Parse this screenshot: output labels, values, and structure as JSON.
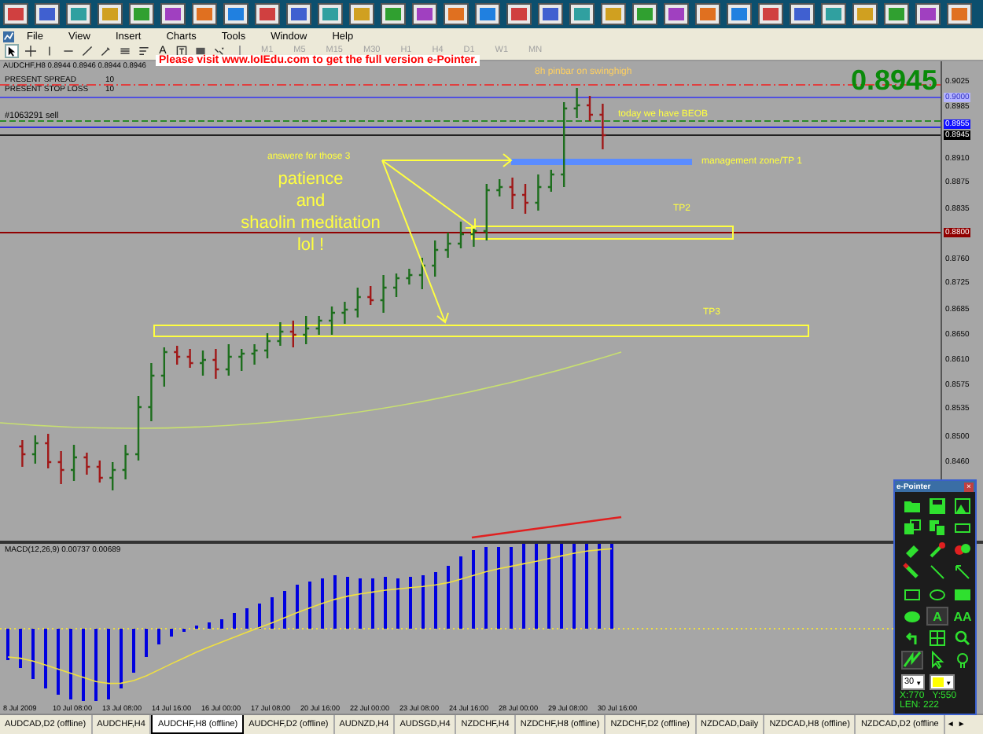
{
  "menu": [
    "File",
    "View",
    "Insert",
    "Charts",
    "Tools",
    "Window",
    "Help"
  ],
  "toolbar": {
    "tools": [
      {
        "kind": "cursor",
        "selected": true
      },
      {
        "kind": "crosshair",
        "selected": false
      },
      {
        "kind": "vline",
        "selected": false
      },
      {
        "kind": "hline",
        "selected": false
      },
      {
        "kind": "trendline",
        "selected": false
      },
      {
        "kind": "pen",
        "selected": false
      },
      {
        "kind": "channel",
        "selected": false
      },
      {
        "kind": "fibo",
        "selected": false
      },
      {
        "kind": "text",
        "label": "A",
        "selected": false
      },
      {
        "kind": "label",
        "selected": false
      },
      {
        "kind": "rect",
        "selected": false
      },
      {
        "kind": "arrows",
        "selected": false
      }
    ],
    "timeframes": [
      {
        "label": "M1",
        "disabled": true
      },
      {
        "label": "M5",
        "disabled": true
      },
      {
        "label": "M15",
        "disabled": true
      },
      {
        "label": "M30",
        "disabled": true
      },
      {
        "label": "H1",
        "disabled": true
      },
      {
        "label": "H4",
        "disabled": true
      },
      {
        "label": "D1",
        "disabled": true
      },
      {
        "label": "W1",
        "disabled": true
      },
      {
        "label": "MN",
        "disabled": true
      }
    ]
  },
  "promo": "Please visit www.IoIEdu.com to get the full version e-Pointer.",
  "chart": {
    "header": "AUDCHF,H8  0.8944 0.8946 0.8944 0.8946",
    "info": [
      {
        "label": "PRESENT SPREAD",
        "value": "10"
      },
      {
        "label": "PRESENT STOP LOSS",
        "value": "10"
      }
    ],
    "order_label": "#1063291 sell",
    "big_price": "0.8945",
    "pinbar_note": "8h pinbar on swinghigh",
    "beob_note": "today we have BEOB",
    "answer_note": "answere for those 3",
    "management_note": "management zone/TP 1",
    "tp2_label": "TP2",
    "tp3_label": "TP3",
    "meditation_lines": [
      "patience",
      "and",
      "shaolin meditation",
      "lol !"
    ],
    "price_axis": [
      {
        "text": "0.9025",
        "kind": "tick"
      },
      {
        "text": "0.9000",
        "kind": "marker",
        "color": "#b4b4ff"
      },
      {
        "text": "0.8985",
        "kind": "tick"
      },
      {
        "text": "0.8955",
        "kind": "marker",
        "color": "#1010ff"
      },
      {
        "text": "0.8945",
        "kind": "marker",
        "color": "#000000"
      },
      {
        "text": "0.8910",
        "kind": "tick"
      },
      {
        "text": "0.8875",
        "kind": "tick"
      },
      {
        "text": "0.8835",
        "kind": "tick"
      },
      {
        "text": "0.8800",
        "kind": "marker",
        "color": "#900000"
      },
      {
        "text": "0.8760",
        "kind": "tick"
      },
      {
        "text": "0.8725",
        "kind": "tick"
      },
      {
        "text": "0.8685",
        "kind": "tick"
      },
      {
        "text": "0.8650",
        "kind": "tick"
      },
      {
        "text": "0.8610",
        "kind": "tick"
      },
      {
        "text": "0.8575",
        "kind": "tick"
      },
      {
        "text": "0.8535",
        "kind": "tick"
      },
      {
        "text": "0.8500",
        "kind": "tick"
      },
      {
        "text": "0.8460",
        "kind": "tick"
      }
    ]
  },
  "macd": {
    "label": "MACD(12,26,9) 0.00737 0.00689",
    "dates": [
      "8 Jul 2009",
      "10 Jul 08:00",
      "13 Jul 08:00",
      "14 Jul 16:00",
      "16 Jul 00:00",
      "17 Jul 08:00",
      "20 Jul 16:00",
      "22 Jul 00:00",
      "23 Jul 08:00",
      "24 Jul 16:00",
      "28 Jul 00:00",
      "29 Jul 08:00",
      "30 Jul 16:00"
    ]
  },
  "tabs": [
    {
      "label": "AUDCAD,D2 (offline)",
      "selected": false
    },
    {
      "label": "AUDCHF,H4",
      "selected": false
    },
    {
      "label": "AUDCHF,H8 (offline)",
      "selected": true
    },
    {
      "label": "AUDCHF,D2 (offline)",
      "selected": false
    },
    {
      "label": "AUDNZD,H4",
      "selected": false
    },
    {
      "label": "AUDSGD,H4",
      "selected": false
    },
    {
      "label": "NZDCHF,H4",
      "selected": false
    },
    {
      "label": "NZDCHF,H8 (offline)",
      "selected": false
    },
    {
      "label": "NZDCHF,D2 (offline)",
      "selected": false
    },
    {
      "label": "NZDCAD,Daily",
      "selected": false
    },
    {
      "label": "NZDCAD,H8 (offline)",
      "selected": false
    },
    {
      "label": "NZDCAD,D2 (offline",
      "selected": false
    }
  ],
  "tab_scroll": [
    "◄",
    "►"
  ],
  "epointer": {
    "title": "e-Pointer",
    "close": "×",
    "tools": [
      {
        "kind": "folder",
        "selected": false
      },
      {
        "kind": "save",
        "selected": false
      },
      {
        "kind": "picture",
        "selected": false
      },
      {
        "kind": "copy-chart",
        "selected": false
      },
      {
        "kind": "copy",
        "selected": false
      },
      {
        "kind": "frame",
        "selected": false
      },
      {
        "kind": "eraser",
        "selected": false
      },
      {
        "kind": "pipette",
        "selected": false
      },
      {
        "kind": "blots",
        "selected": false
      },
      {
        "kind": "marker",
        "selected": false
      },
      {
        "kind": "line",
        "selected": false
      },
      {
        "kind": "arrow",
        "selected": false
      },
      {
        "kind": "rect",
        "selected": false
      },
      {
        "kind": "ellipse",
        "selected": false
      },
      {
        "kind": "filled-rect",
        "selected": false
      },
      {
        "kind": "filled-ellipse",
        "selected": false
      },
      {
        "kind": "text",
        "label": "A",
        "selected": true
      },
      {
        "kind": "text",
        "label": "AA",
        "selected": false
      },
      {
        "kind": "undo",
        "selected": false
      },
      {
        "kind": "grid",
        "selected": false
      },
      {
        "kind": "magnifier",
        "selected": false
      },
      {
        "kind": "zigzag",
        "selected": true
      },
      {
        "kind": "pointer",
        "selected": false
      },
      {
        "kind": "bulb",
        "selected": false
      }
    ],
    "width_value": "30",
    "dropdown_caret": "▼",
    "color": "#ffff00",
    "x_reading": "X:770",
    "y_reading": "Y:550",
    "len_reading": "LEN: 222"
  }
}
